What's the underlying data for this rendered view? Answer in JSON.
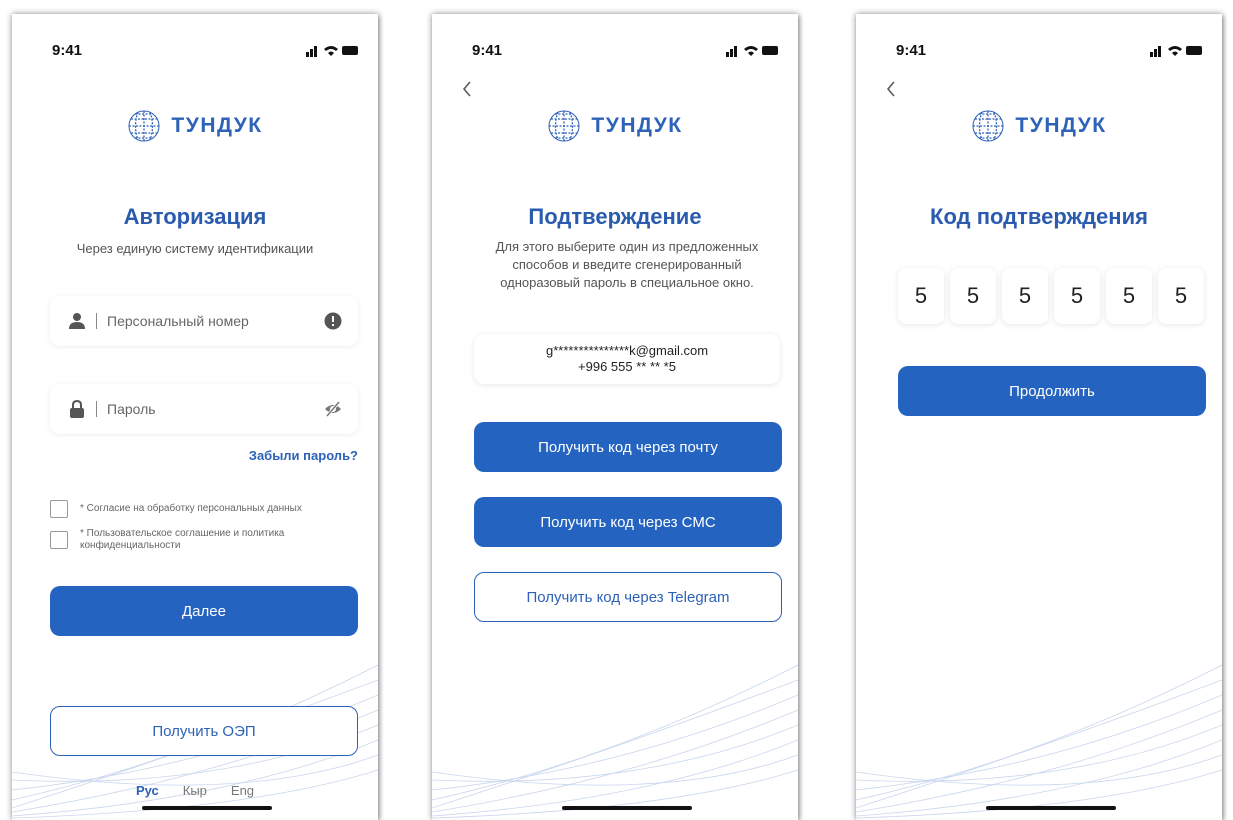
{
  "brand": {
    "logo_text": "ТУНДУК",
    "primary_color": "#2563C0",
    "title_color": "#2A5BAE"
  },
  "status_bar": {
    "time": "9:41"
  },
  "screen1": {
    "title": "Авторизация",
    "subtitle": "Через единую систему идентификации",
    "personal_number_placeholder": "Персональный номер",
    "password_placeholder": "Пароль",
    "forgot_password": "Забыли пароль?",
    "consents": [
      "* Согласие на обработку персональных данных",
      "* Пользовательское соглашение и политика конфиденциальности"
    ],
    "next_button": "Далее",
    "get_oep_button": "Получить ОЭП",
    "languages": [
      "Рус",
      "Кыр",
      "Eng"
    ],
    "active_language": "Рус"
  },
  "screen2": {
    "title": "Подтверждение",
    "subtitle": "Для этого выберите один из предложенных способов и введите сгенерированный одноразовый пароль в специальное окно.",
    "email": "g***************k@gmail.com",
    "phone": "+996 555 ** ** *5",
    "email_button": "Получить код через почту",
    "sms_button": "Получить код через СМС",
    "telegram_button": "Получить код через Telegram"
  },
  "screen3": {
    "title": "Код подтверждения",
    "code_digits": [
      "5",
      "5",
      "5",
      "5",
      "5",
      "5"
    ],
    "continue_button": "Продолжить"
  }
}
